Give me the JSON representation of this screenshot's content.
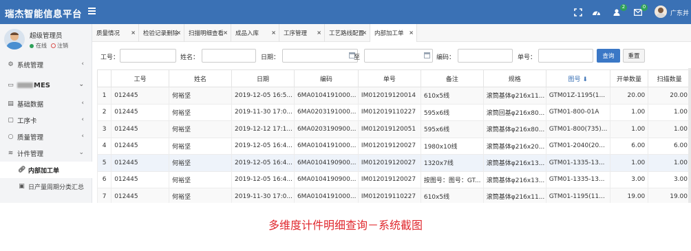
{
  "app": {
    "title": "瑞杰智能信息平台"
  },
  "topbar": {
    "badge_notify": "2",
    "badge_mail": "0",
    "user_name": "广东并"
  },
  "sidebar": {
    "user_name": "超级管理员",
    "status_online": "在线",
    "logout": "注销",
    "items": [
      {
        "label": "系统管理",
        "icon": "gear-icon"
      },
      {
        "label": "MES",
        "icon": "monitor-icon"
      },
      {
        "label": "基础数据",
        "icon": "table-icon"
      },
      {
        "label": "工序卡",
        "icon": "card-icon"
      },
      {
        "label": "质量管理",
        "icon": "circle-icon"
      },
      {
        "label": "计件管理",
        "icon": "layers-icon"
      },
      {
        "label": "内部加工单",
        "icon": "link-icon"
      },
      {
        "label": "日产量周期分类汇总",
        "icon": "calendar-icon"
      }
    ]
  },
  "tabs": [
    {
      "label": "质量情况"
    },
    {
      "label": "检验记录删除"
    },
    {
      "label": "扫描明细查看"
    },
    {
      "label": "成品入库"
    },
    {
      "label": "工序管理"
    },
    {
      "label": "工艺路线配置"
    },
    {
      "label": "内部加工单"
    }
  ],
  "filters": {
    "gonghao_label": "工号：",
    "name_label": "姓名：",
    "date_label": "日期：",
    "to_label": "至",
    "code_label": "编码：",
    "order_label": "单号：",
    "search_btn": "查询",
    "reset_btn": "重置"
  },
  "table": {
    "columns": [
      "",
      "工号",
      "姓名",
      "日期",
      "编码",
      "单号",
      "备注",
      "规格",
      "图号",
      "开单数量",
      "扫描数量"
    ],
    "rows": [
      [
        "1",
        "012445",
        "何裕坚",
        "2019-12-05 16:5...",
        "6MA0104191000...",
        "IM012019120014",
        "610x5线",
        "滚筒基体φ216x11...",
        "GTM01Z-1195(1...",
        "20.00",
        "20.00"
      ],
      [
        "2",
        "012445",
        "何裕坚",
        "2019-11-30 17:0...",
        "6MA0203191000...",
        "IM012019110227",
        "595x6线",
        "滚筒回基φ216x80...",
        "GTM01-800-01A",
        "1.00",
        "1.00"
      ],
      [
        "3",
        "012445",
        "何裕坚",
        "2019-12-12 17:1...",
        "6MA0203190900...",
        "IM012019120051",
        "595x6线",
        "滚筒基体φ216x80...",
        "GTM01-800(735)...",
        "1.00",
        "1.00"
      ],
      [
        "4",
        "012445",
        "何裕坚",
        "2019-12-05 16:4...",
        "6MA0104191000...",
        "IM012019120027",
        "1980x10线",
        "滚筒基体φ216x20...",
        "GTM01-2040(20...",
        "6.00",
        "6.00"
      ],
      [
        "5",
        "012445",
        "何裕坚",
        "2019-12-05 16:4...",
        "6MA0104190900...",
        "IM012019120027",
        "1320x7线",
        "滚筒基体φ216x13...",
        "GTM01-1335-13...",
        "1.00",
        "1.00"
      ],
      [
        "6",
        "012445",
        "何裕坚",
        "2019-12-05 16:4...",
        "6MA0104190900...",
        "IM012019120027",
        "按图号：图号：GT...",
        "滚筒基体φ216x13...",
        "GTM01-1335-13...",
        "3.00",
        "3.00"
      ],
      [
        "7",
        "012445",
        "何裕坚",
        "2019-11-30 17:0...",
        "6MA0104191000...",
        "IM012019110227",
        "610x5线",
        "滚筒基体φ216x11...",
        "GTM01-1195(11...",
        "19.00",
        "19.00"
      ]
    ]
  },
  "caption": "多维度计件明细查询－系统截图",
  "colors": {
    "topbar": "#3a71b5",
    "primary_button": "#3b78c6",
    "caption": "#e0282e"
  }
}
